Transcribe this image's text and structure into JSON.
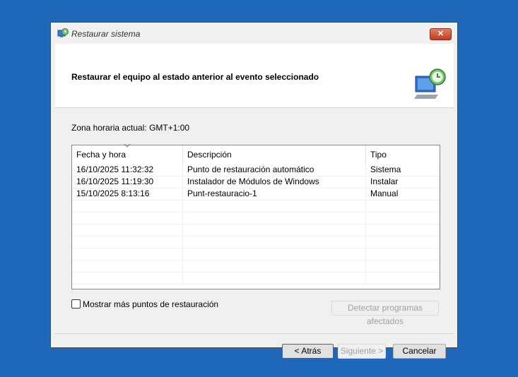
{
  "window": {
    "title": "Restaurar sistema",
    "close_label": "✕"
  },
  "header": {
    "title": "Restaurar el equipo al estado anterior al evento seleccionado",
    "icon": "system-restore-icon"
  },
  "timezone_label": "Zona horaria actual: GMT+1:00",
  "list": {
    "columns": [
      "Fecha y hora",
      "Descripción",
      "Tipo"
    ],
    "sorted_column": "Fecha y hora",
    "rows": [
      [
        "16/10/2025 11:32:32",
        "Punto de restauración automático",
        "Sistema"
      ],
      [
        "16/10/2025 11:19:30",
        "Instalador de Módulos de Windows",
        "Instalar"
      ],
      [
        "15/10/2025 8:13:16",
        "Punt-restauracio-1",
        "Manual"
      ]
    ]
  },
  "show_more": {
    "label": "Mostrar más puntos de restauración",
    "checked": false
  },
  "buttons": {
    "detect": "Detectar programas afectados",
    "back": "< Atrás",
    "next": "Siguiente >",
    "cancel": "Cancelar"
  },
  "colors": {
    "desktop": "#1f67b8",
    "close_button": "#c13b20",
    "focus_border": "#0078d7"
  }
}
